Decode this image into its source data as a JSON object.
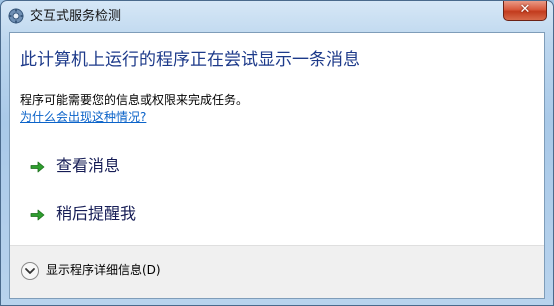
{
  "window": {
    "title": "交互式服务检测",
    "close_label": "✕"
  },
  "dialog": {
    "main_instruction": "此计算机上运行的程序正在尝试显示一条消息",
    "content": "程序可能需要您的信息或权限来完成任务。",
    "help_link": "为什么会出现这种情况?",
    "commands": [
      {
        "label": "查看消息",
        "icon": "green-arrow-icon"
      },
      {
        "label": "稍后提醒我",
        "icon": "green-arrow-icon"
      }
    ],
    "footer": {
      "details_label": "显示程序详细信息(D)",
      "icon": "chevron-down-icon"
    }
  },
  "colors": {
    "main_instruction": "#1d3a8a",
    "link": "#0b63c9",
    "arrow": "#2f9e2f",
    "close_button": "#c23b1d"
  }
}
